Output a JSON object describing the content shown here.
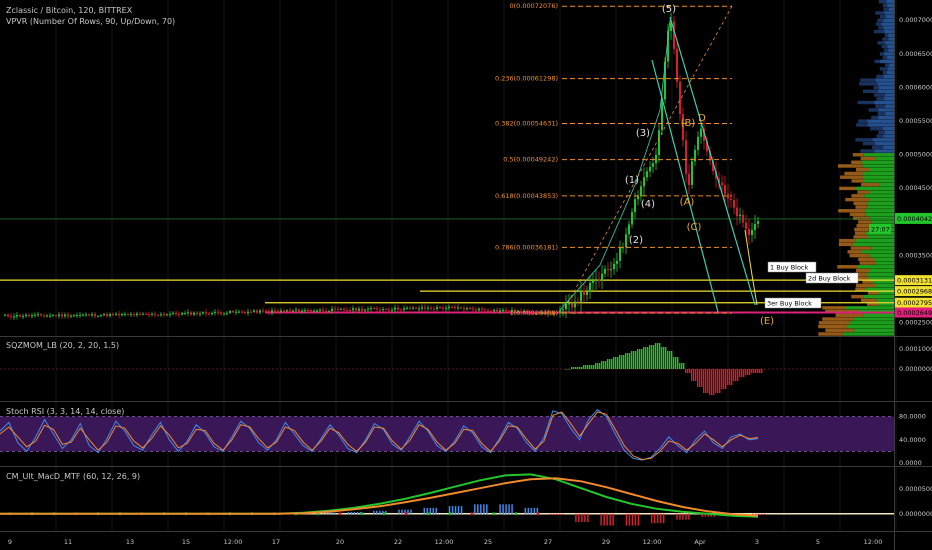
{
  "header": {
    "main_title": "Zclassic / Bitcoin, 120, BITTREX",
    "vpvr_title": "VPVR (Number Of Rows, 90, Up/Down, 70)"
  },
  "colors": {
    "up": "#22c52a",
    "down": "#d81e2a",
    "fib": "#f0912a",
    "yellow": "#f0e030",
    "magenta": "#e0207a",
    "teal": "#3ccfb2",
    "stoch_band": "#3a1858"
  },
  "chart_data": [
    {
      "type": "candlestick",
      "panel": "price",
      "price_scale": [
        "0.00070000",
        "0.00065000",
        "0.00060000",
        "0.00055000",
        "0.00050000",
        "0.00045000",
        "0.00035000",
        "0.00025000"
      ],
      "ylim": [
        0.00023,
        0.00073
      ],
      "current_price": {
        "value": "0.00040422",
        "countdown": "27:07"
      },
      "price_marks": [
        {
          "value": 0.00031312,
          "label": "0.00031312",
          "color": "#f0e030"
        },
        {
          "value": 0.00029681,
          "label": "0.00029681",
          "color": "#f0e030"
        },
        {
          "value": 0.00027953,
          "label": "0.00027953",
          "color": "#f0e030"
        },
        {
          "value": 0.00026495,
          "label": "0.00026495",
          "color": "#e0207a"
        }
      ],
      "fib_levels": [
        {
          "ratio": "0",
          "price": 0.00072076,
          "label": "0(0.00072076)"
        },
        {
          "ratio": "0.236",
          "price": 0.00061298,
          "label": "0.236(0.00061298)"
        },
        {
          "ratio": "0.382",
          "price": 0.00054631,
          "label": "0.382(0.00054631)"
        },
        {
          "ratio": "0.5",
          "price": 0.00049242,
          "label": "0.5(0.00049242)"
        },
        {
          "ratio": "0.618",
          "price": 0.00043853,
          "label": "0.618(0.00043853)"
        },
        {
          "ratio": "0.786",
          "price": 0.00036181,
          "label": "0.786(0.00036181)"
        },
        {
          "ratio": "1",
          "price": 0.00026408,
          "label": "1(0.00026408)"
        }
      ],
      "wave_labels": [
        {
          "text": "(1)",
          "color": "#e0e0e0"
        },
        {
          "text": "(2)",
          "color": "#e0e0e0"
        },
        {
          "text": "(3)",
          "color": "#e0e0e0"
        },
        {
          "text": "(4)",
          "color": "#e0e0e0"
        },
        {
          "text": "(5)",
          "color": "#e0e0e0"
        },
        {
          "text": "(A)",
          "color": "#f5a623"
        },
        {
          "text": "(B)",
          "color": "#f5a623"
        },
        {
          "text": "(C)",
          "color": "#f5a623"
        },
        {
          "text": "D",
          "color": "#f5a623"
        },
        {
          "text": "(E)",
          "color": "#f5a623"
        }
      ],
      "buy_blocks": [
        "1 Buy Block",
        "2d Buy Block",
        "3er Buy Block"
      ]
    },
    {
      "type": "histogram",
      "panel": "sqzmom",
      "title": "SQZMOM_LB (20, 2, 20, 1.5)",
      "scale": [
        "0.00010000",
        "0.00000000"
      ],
      "ylim": [
        -0.00016,
        0.00016
      ],
      "values": [
        0.0,
        1e-05,
        1e-05,
        2e-05,
        2e-05,
        3e-05,
        4e-05,
        5e-05,
        6e-05,
        7e-05,
        8e-05,
        9e-05,
        0.0001,
        0.00011,
        0.00012,
        0.00013,
        0.00011,
        9e-05,
        6e-05,
        3e-05,
        -2e-05,
        -6e-05,
        -9e-05,
        -0.00012,
        -0.00013,
        -0.00012,
        -0.0001,
        -8e-05,
        -6e-05,
        -4e-05,
        -3e-05,
        -2e-05,
        -2e-05
      ]
    },
    {
      "type": "line",
      "panel": "stoch_rsi",
      "title": "Stoch RSI (3, 3, 14, 14, close)",
      "scale": [
        "80.0000",
        "40.0000",
        "0.0000"
      ],
      "ylim": [
        0,
        100
      ],
      "band": [
        20,
        80
      ],
      "series": [
        {
          "color": "#3c8cf0",
          "values": [
            55,
            70,
            35,
            20,
            45,
            75,
            50,
            25,
            40,
            68,
            30,
            18,
            42,
            72,
            55,
            30,
            22,
            48,
            70,
            40,
            20,
            38,
            66,
            52,
            28,
            20,
            45,
            72,
            60,
            35,
            22,
            40,
            70,
            50,
            30,
            20,
            42,
            66,
            48,
            25,
            18,
            40,
            68,
            58,
            32,
            22,
            46,
            72,
            55,
            30,
            20,
            38,
            64,
            52,
            28,
            18,
            42,
            70,
            60,
            36,
            20,
            44,
            90,
            85,
            60,
            40,
            75,
            92,
            80,
            50,
            22,
            8,
            5,
            10,
            25,
            45,
            30,
            18,
            40,
            55,
            35,
            25,
            45,
            50,
            40,
            42
          ]
        },
        {
          "color": "#f08a2a",
          "values": [
            50,
            62,
            45,
            28,
            38,
            65,
            58,
            32,
            36,
            60,
            40,
            22,
            36,
            64,
            60,
            38,
            26,
            42,
            64,
            48,
            26,
            34,
            58,
            56,
            34,
            22,
            40,
            66,
            62,
            42,
            26,
            36,
            62,
            56,
            36,
            22,
            38,
            60,
            52,
            32,
            20,
            36,
            62,
            60,
            38,
            24,
            40,
            66,
            58,
            36,
            22,
            34,
            58,
            56,
            34,
            20,
            38,
            64,
            62,
            42,
            24,
            38,
            82,
            88,
            68,
            46,
            68,
            88,
            84,
            58,
            30,
            12,
            6,
            8,
            20,
            38,
            34,
            22,
            34,
            50,
            40,
            28,
            40,
            48,
            42,
            44
          ]
        }
      ]
    },
    {
      "type": "line",
      "panel": "macd",
      "title": "CM_Ult_MacD_MTF (60, 12, 26, 9)",
      "scale": [
        "0.00005000",
        "0.00000000"
      ],
      "ylim": [
        -3.5e-05,
        9.5e-05
      ],
      "series": [
        {
          "color": "#22c52a",
          "values": [
            0,
            0,
            0,
            0,
            0,
            0,
            0,
            0,
            0,
            0,
            0,
            0,
            2e-06,
            6e-06,
            1.2e-05,
            2e-05,
            3e-05,
            4.2e-05,
            5.5e-05,
            6.8e-05,
            7.8e-05,
            8e-05,
            7e-05,
            5.2e-05,
            3.4e-05,
            2e-05,
            1e-05,
            4e-06,
            0.0,
            -4e-06,
            -6e-06
          ]
        },
        {
          "color": "#f08a2a",
          "values": [
            0,
            0,
            0,
            0,
            0,
            0,
            0,
            0,
            0,
            0,
            0,
            0,
            1e-06,
            4e-06,
            9e-06,
            1.5e-05,
            2.3e-05,
            3.2e-05,
            4.2e-05,
            5.2e-05,
            6.2e-05,
            7e-05,
            7.2e-05,
            6.6e-05,
            5.4e-05,
            4e-05,
            2.6e-05,
            1.4e-05,
            5e-06,
            -1e-06,
            -4e-06
          ]
        }
      ]
    }
  ],
  "time_axis": [
    "9",
    "11",
    "13",
    "15",
    "12:00",
    "17",
    "20",
    "22",
    "12:00",
    "25",
    "27",
    "29",
    "12:00",
    "Apr",
    "3",
    "5",
    "12:00"
  ]
}
